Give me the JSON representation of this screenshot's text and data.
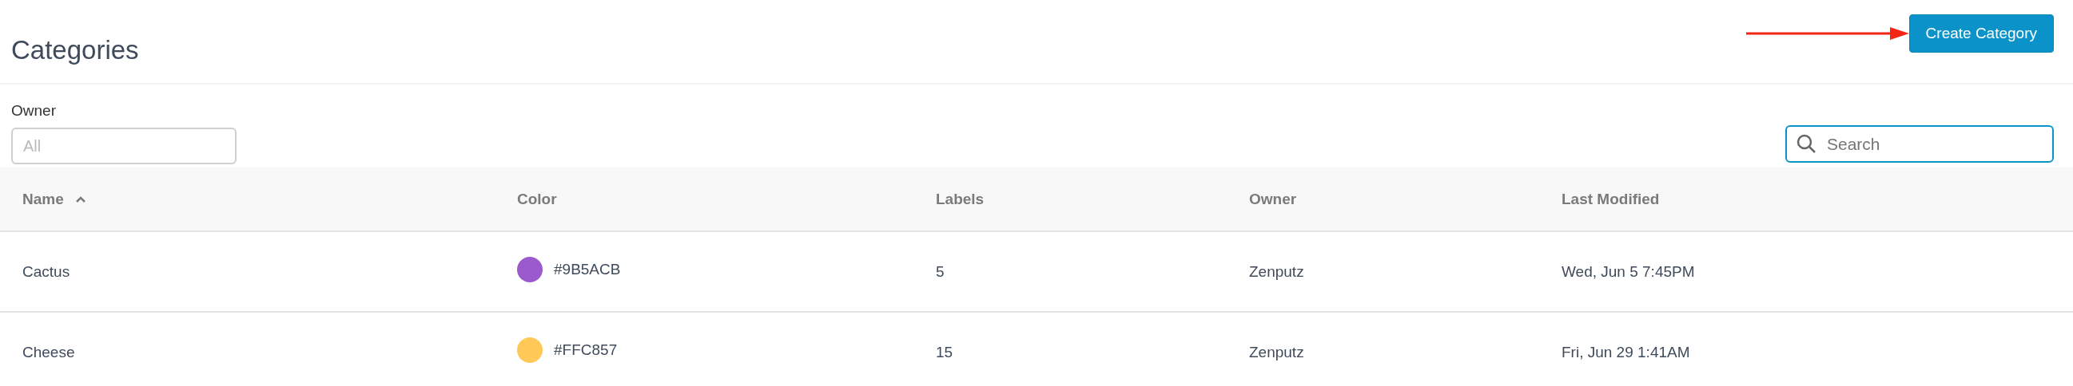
{
  "page": {
    "title": "Categories"
  },
  "create_button": {
    "label": "Create Category"
  },
  "owner_filter": {
    "label": "Owner",
    "placeholder": "All"
  },
  "search": {
    "placeholder": "Search"
  },
  "table": {
    "columns": [
      {
        "label": "Name",
        "sorted": true
      },
      {
        "label": "Color",
        "sorted": false
      },
      {
        "label": "Labels",
        "sorted": false
      },
      {
        "label": "Owner",
        "sorted": false
      },
      {
        "label": "Last Modified",
        "sorted": false
      }
    ],
    "rows": [
      {
        "name": "Cactus",
        "color": "#9b5acb",
        "color_text": "#9B5ACB",
        "labels": "5",
        "owner": "Zenputz",
        "last_modified": "Wed, Jun 5 7:45PM"
      },
      {
        "name": "Cheese",
        "color": "#ffc857",
        "color_text": "#FFC857",
        "labels": "15",
        "owner": "Zenputz",
        "last_modified": "Fri, Jun 29 1:41AM"
      }
    ]
  }
}
